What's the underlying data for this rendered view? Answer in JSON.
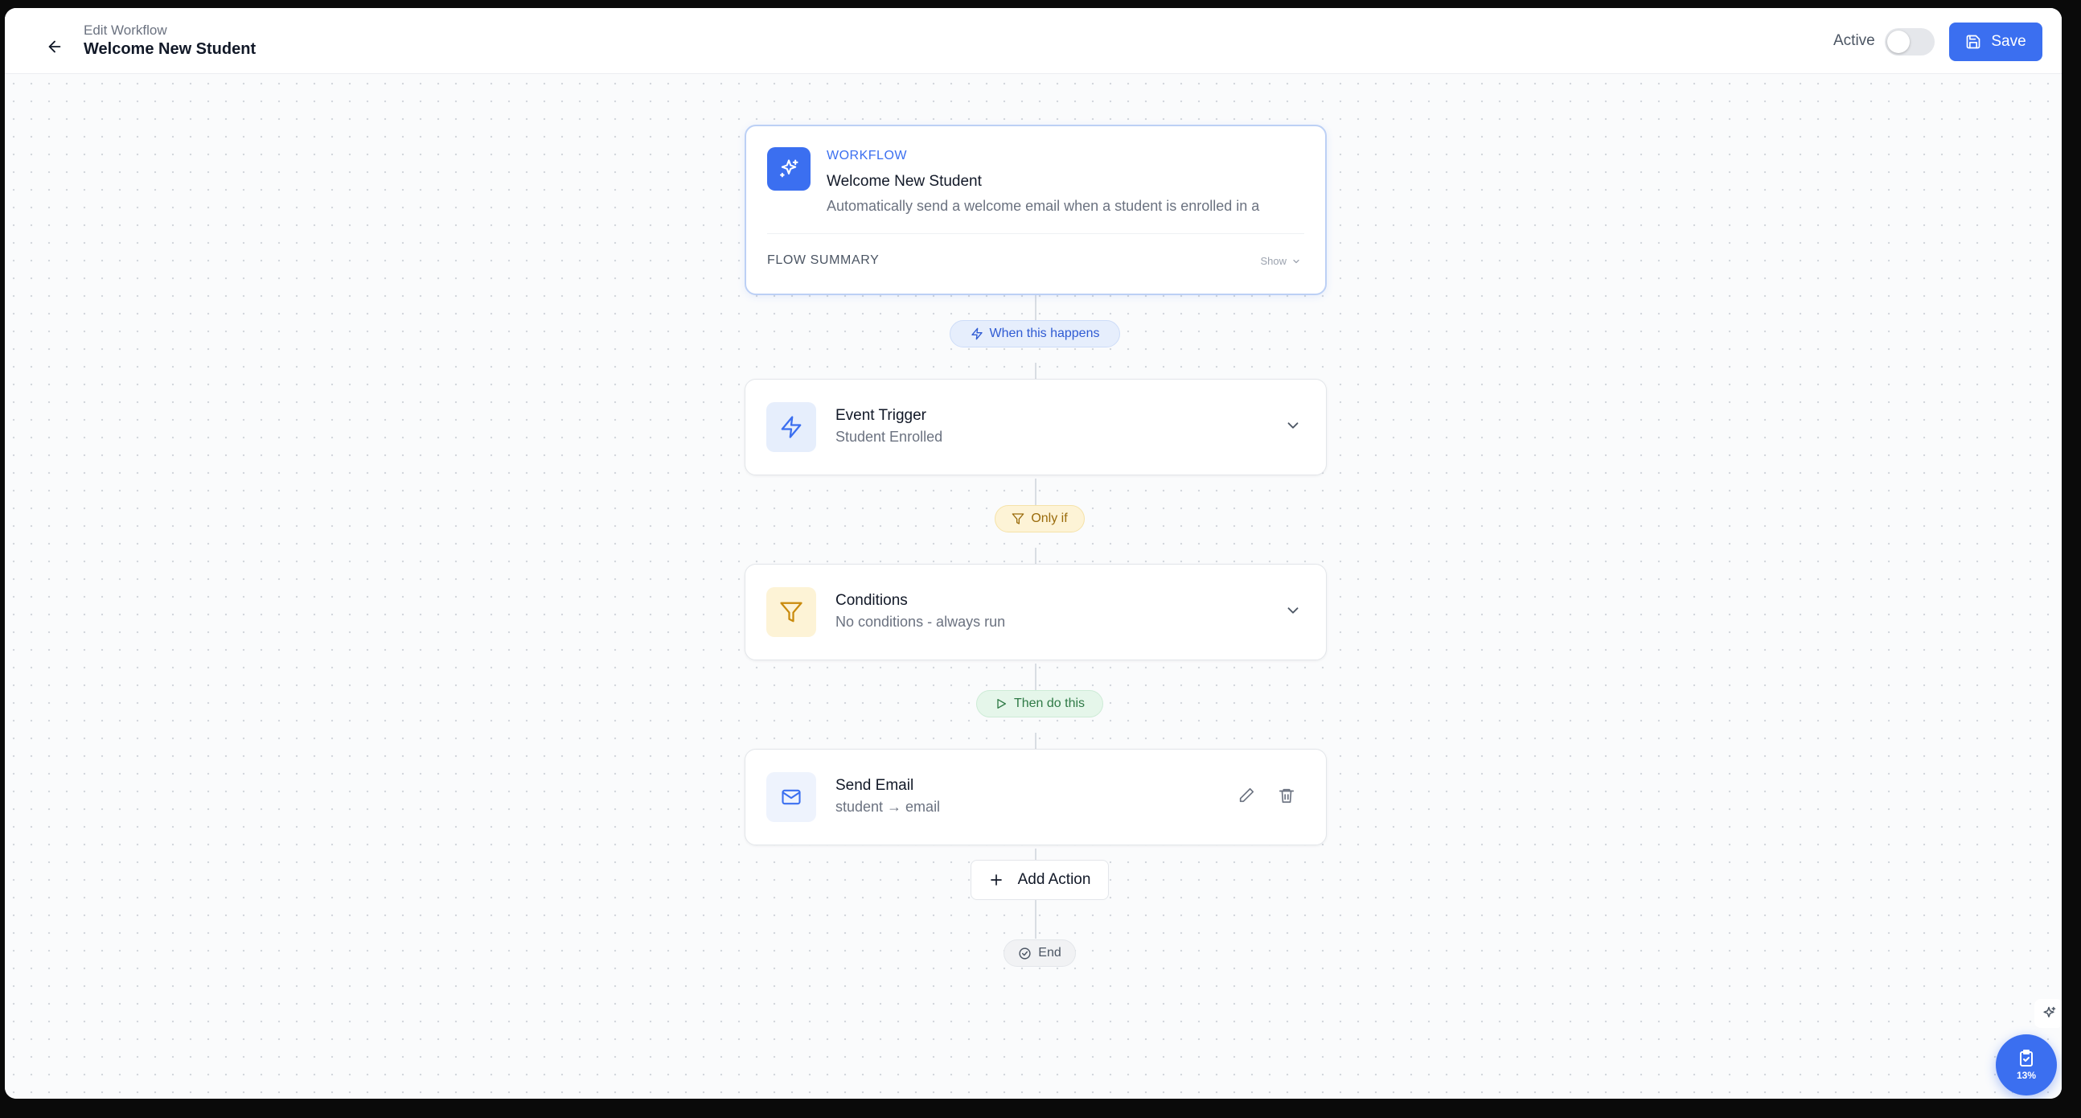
{
  "header": {
    "breadcrumb": "Edit Workflow",
    "title": "Welcome New Student",
    "active_label": "Active",
    "active": false,
    "save_label": "Save"
  },
  "workflow_card": {
    "eyebrow": "WORKFLOW",
    "name": "Welcome New Student",
    "description": "Automatically send a welcome email when a student is enrolled in a",
    "flow_summary_label": "FLOW SUMMARY",
    "show_label": "Show"
  },
  "pills": {
    "trigger": "When this happens",
    "conditions": "Only if",
    "actions": "Then do this",
    "end": "End"
  },
  "steps": {
    "trigger": {
      "title": "Event Trigger",
      "subtitle": "Student Enrolled"
    },
    "conditions": {
      "title": "Conditions",
      "subtitle": "No conditions - always run"
    },
    "action": {
      "title": "Send Email",
      "subtitle": "student → email"
    }
  },
  "add_action_label": "Add Action",
  "fab": {
    "percent": "13%"
  },
  "colors": {
    "accent": "#3b6ff0",
    "trigger_bg": "#e6eefc",
    "condition_bg": "#fdf3d6",
    "action_bg": "#eef3fd"
  }
}
